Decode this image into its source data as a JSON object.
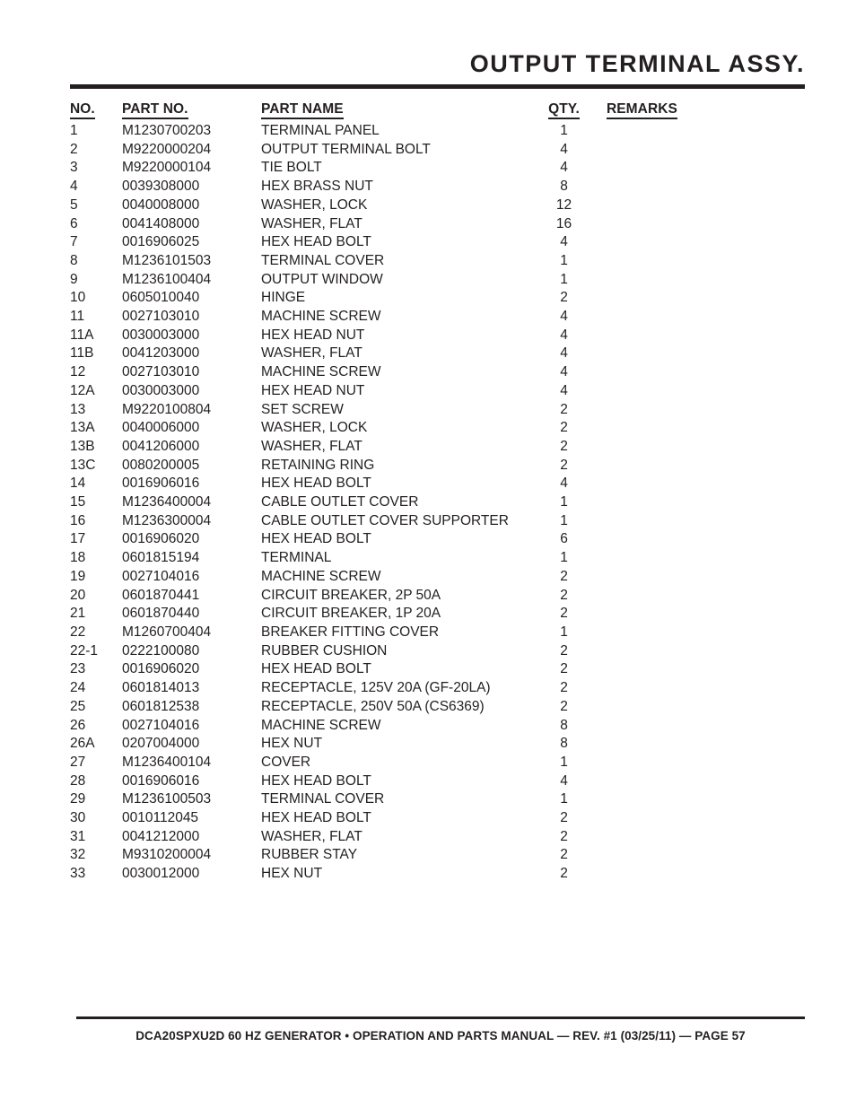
{
  "header": {
    "title": "OUTPUT TERMINAL ASSY."
  },
  "table": {
    "columns": {
      "no": "NO.",
      "part_no": "PART NO.",
      "part_name": "PART NAME",
      "qty": "QTY.",
      "remarks": "REMARKS"
    },
    "rows": [
      {
        "no": "1",
        "part_no": "M1230700203",
        "part_name": "TERMINAL PANEL",
        "qty": "1",
        "remarks": ""
      },
      {
        "no": "2",
        "part_no": "M9220000204",
        "part_name": "OUTPUT TERMINAL BOLT",
        "qty": "4",
        "remarks": ""
      },
      {
        "no": "3",
        "part_no": "M9220000104",
        "part_name": "TIE BOLT",
        "qty": "4",
        "remarks": ""
      },
      {
        "no": "4",
        "part_no": "0039308000",
        "part_name": "HEX BRASS NUT",
        "qty": "8",
        "remarks": ""
      },
      {
        "no": "5",
        "part_no": "0040008000",
        "part_name": "WASHER, LOCK",
        "qty": "12",
        "remarks": ""
      },
      {
        "no": "6",
        "part_no": "0041408000",
        "part_name": "WASHER, FLAT",
        "qty": "16",
        "remarks": ""
      },
      {
        "no": "7",
        "part_no": "0016906025",
        "part_name": "HEX HEAD BOLT",
        "qty": "4",
        "remarks": ""
      },
      {
        "no": "8",
        "part_no": "M1236101503",
        "part_name": "TERMINAL COVER",
        "qty": "1",
        "remarks": ""
      },
      {
        "no": "9",
        "part_no": "M1236100404",
        "part_name": "OUTPUT WINDOW",
        "qty": "1",
        "remarks": ""
      },
      {
        "no": "10",
        "part_no": "0605010040",
        "part_name": "HINGE",
        "qty": "2",
        "remarks": ""
      },
      {
        "no": "11",
        "part_no": "0027103010",
        "part_name": "MACHINE SCREW",
        "qty": "4",
        "remarks": ""
      },
      {
        "no": "11A",
        "part_no": "0030003000",
        "part_name": "HEX HEAD NUT",
        "qty": "4",
        "remarks": ""
      },
      {
        "no": "11B",
        "part_no": "0041203000",
        "part_name": "WASHER, FLAT",
        "qty": "4",
        "remarks": ""
      },
      {
        "no": "12",
        "part_no": "0027103010",
        "part_name": "MACHINE SCREW",
        "qty": "4",
        "remarks": ""
      },
      {
        "no": "12A",
        "part_no": "0030003000",
        "part_name": "HEX HEAD NUT",
        "qty": "4",
        "remarks": ""
      },
      {
        "no": "13",
        "part_no": "M9220100804",
        "part_name": "SET SCREW",
        "qty": "2",
        "remarks": ""
      },
      {
        "no": "13A",
        "part_no": "0040006000",
        "part_name": "WASHER, LOCK",
        "qty": "2",
        "remarks": ""
      },
      {
        "no": "13B",
        "part_no": "0041206000",
        "part_name": "WASHER, FLAT",
        "qty": "2",
        "remarks": ""
      },
      {
        "no": "13C",
        "part_no": "0080200005",
        "part_name": "RETAINING RING",
        "qty": "2",
        "remarks": ""
      },
      {
        "no": "14",
        "part_no": "0016906016",
        "part_name": "HEX HEAD BOLT",
        "qty": "4",
        "remarks": ""
      },
      {
        "no": "15",
        "part_no": "M1236400004",
        "part_name": "CABLE OUTLET COVER",
        "qty": "1",
        "remarks": ""
      },
      {
        "no": "16",
        "part_no": "M1236300004",
        "part_name": "CABLE OUTLET COVER SUPPORTER",
        "qty": "1",
        "remarks": ""
      },
      {
        "no": "17",
        "part_no": "0016906020",
        "part_name": "HEX HEAD BOLT",
        "qty": "6",
        "remarks": ""
      },
      {
        "no": "18",
        "part_no": "0601815194",
        "part_name": "TERMINAL",
        "qty": "1",
        "remarks": ""
      },
      {
        "no": "19",
        "part_no": "0027104016",
        "part_name": "MACHINE SCREW",
        "qty": "2",
        "remarks": ""
      },
      {
        "no": "20",
        "part_no": "0601870441",
        "part_name": "CIRCUIT BREAKER, 2P 50A",
        "qty": "2",
        "remarks": ""
      },
      {
        "no": "21",
        "part_no": "0601870440",
        "part_name": "CIRCUIT BREAKER, 1P 20A",
        "qty": "2",
        "remarks": ""
      },
      {
        "no": "22",
        "part_no": "M1260700404",
        "part_name": "BREAKER FITTING COVER",
        "qty": "1",
        "remarks": ""
      },
      {
        "no": "22-1",
        "part_no": "0222100080",
        "part_name": "RUBBER CUSHION",
        "qty": "2",
        "remarks": ""
      },
      {
        "no": "23",
        "part_no": "0016906020",
        "part_name": "HEX HEAD BOLT",
        "qty": "2",
        "remarks": ""
      },
      {
        "no": "24",
        "part_no": "0601814013",
        "part_name": "RECEPTACLE, 125V 20A (GF-20LA)",
        "qty": "2",
        "remarks": ""
      },
      {
        "no": "25",
        "part_no": "0601812538",
        "part_name": "RECEPTACLE, 250V 50A (CS6369)",
        "qty": "2",
        "remarks": ""
      },
      {
        "no": "26",
        "part_no": "0027104016",
        "part_name": "MACHINE SCREW",
        "qty": "8",
        "remarks": ""
      },
      {
        "no": "26A",
        "part_no": "0207004000",
        "part_name": "HEX NUT",
        "qty": "8",
        "remarks": ""
      },
      {
        "no": "27",
        "part_no": "M1236400104",
        "part_name": "COVER",
        "qty": "1",
        "remarks": ""
      },
      {
        "no": "28",
        "part_no": "0016906016",
        "part_name": "HEX HEAD BOLT",
        "qty": "4",
        "remarks": ""
      },
      {
        "no": "29",
        "part_no": "M1236100503",
        "part_name": "TERMINAL COVER",
        "qty": "1",
        "remarks": ""
      },
      {
        "no": "30",
        "part_no": "0010112045",
        "part_name": "HEX HEAD BOLT",
        "qty": "2",
        "remarks": ""
      },
      {
        "no": "31",
        "part_no": "0041212000",
        "part_name": "WASHER, FLAT",
        "qty": "2",
        "remarks": ""
      },
      {
        "no": "32",
        "part_no": "M9310200004",
        "part_name": "RUBBER STAY",
        "qty": "2",
        "remarks": ""
      },
      {
        "no": "33",
        "part_no": "0030012000",
        "part_name": "HEX NUT",
        "qty": "2",
        "remarks": ""
      }
    ]
  },
  "footer": {
    "text": "DCA20SPXU2D 60 HZ GENERATOR • OPERATION AND PARTS MANUAL — REV. #1 (03/25/11) — PAGE 57"
  }
}
